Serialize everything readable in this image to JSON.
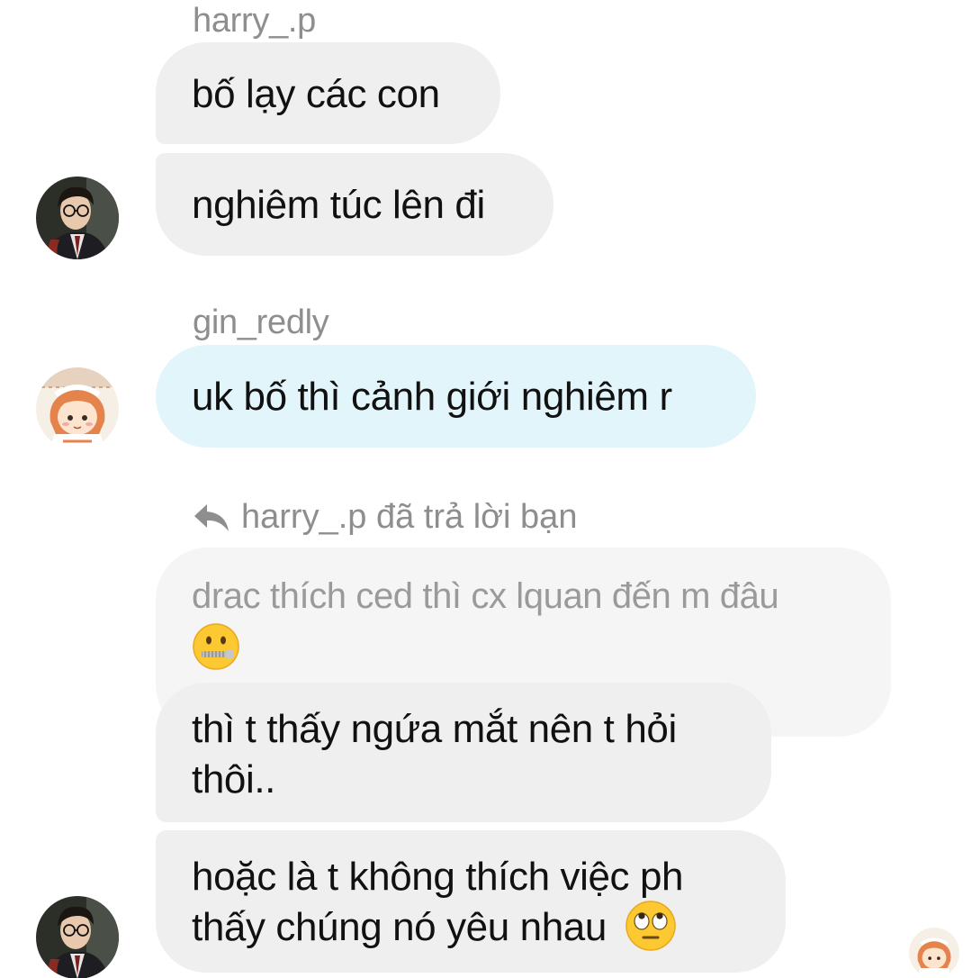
{
  "messages": {
    "group1": {
      "sender": "harry_.p",
      "bubble1": "bố lạy các con",
      "bubble2": "nghiêm túc lên đi"
    },
    "group2": {
      "sender": "gin_redly",
      "bubble1": "uk bố thì cảnh giới nghiêm r"
    },
    "group3": {
      "reply_notice": "harry_.p đã trả lời bạn",
      "quoted_text": "drac thích ced thì cx lquan đến m đâu",
      "quoted_emoji": "zipper-mouth-face-icon",
      "bubble1_line1": "thì t thấy ngứa mắt nên t hỏi",
      "bubble1_line2": "thôi..",
      "bubble2_line1": "hoặc là t không thích việc ph",
      "bubble2_line2": "thấy chúng nó yêu nhau",
      "bubble2_emoji": "face-with-rolling-eyes-icon"
    }
  },
  "colors": {
    "incoming_bubble": "#efefef",
    "highlight_bubble": "#e2f5fa",
    "quoted_bubble": "#f5f5f5",
    "meta_text": "#8e8e8e"
  }
}
